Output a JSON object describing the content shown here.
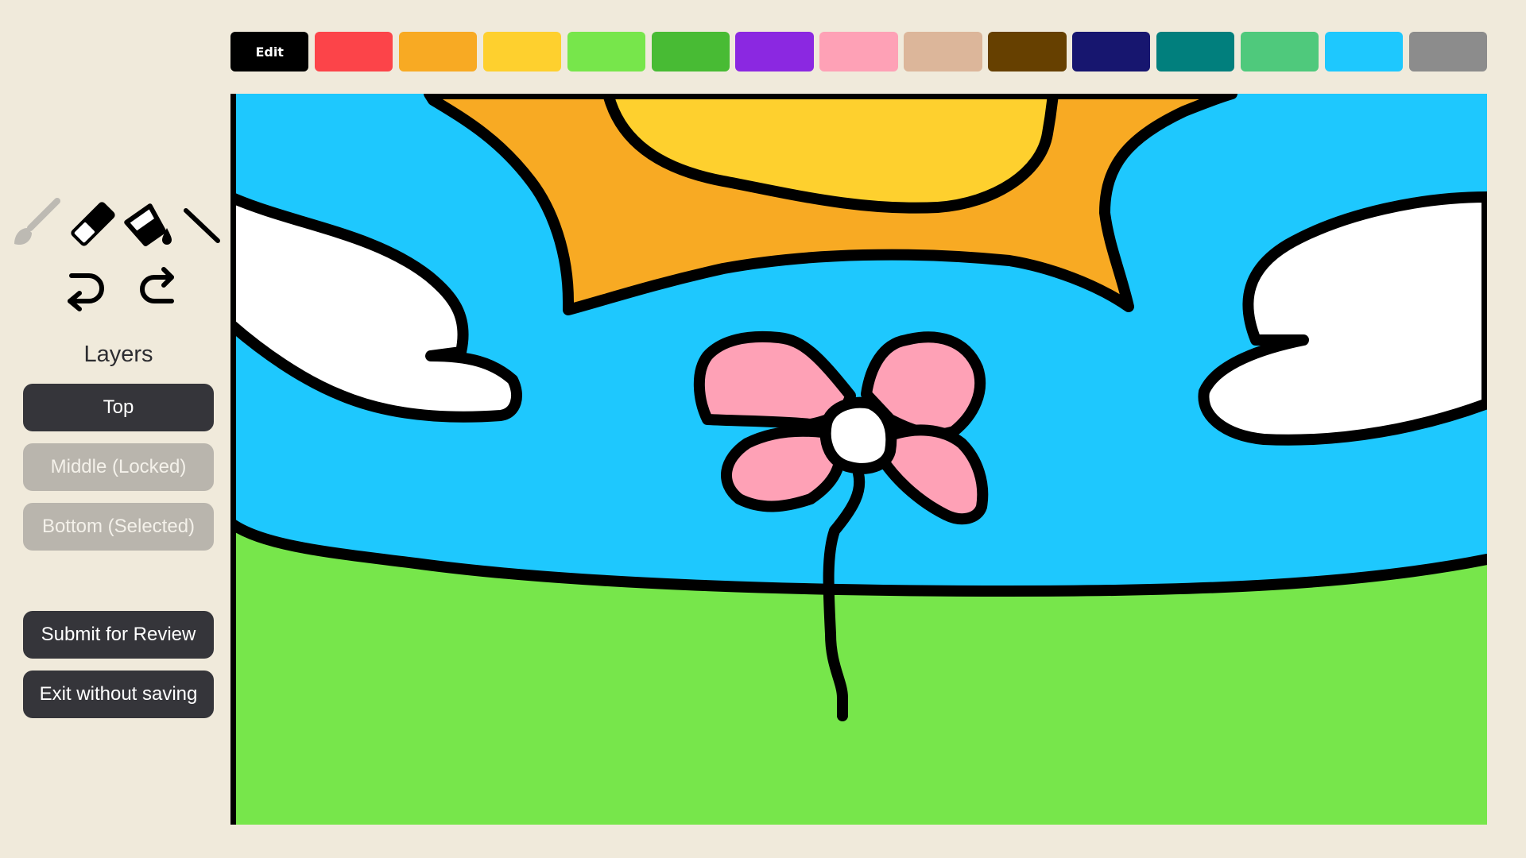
{
  "palette": {
    "edit_label": "Edit",
    "colors": [
      {
        "name": "red",
        "hex": "#fc4449"
      },
      {
        "name": "orange",
        "hex": "#f8aa23"
      },
      {
        "name": "yellow",
        "hex": "#fed02e"
      },
      {
        "name": "light-green",
        "hex": "#77e64b"
      },
      {
        "name": "green",
        "hex": "#48bb34"
      },
      {
        "name": "purple",
        "hex": "#8b28e1"
      },
      {
        "name": "pink",
        "hex": "#fea1b6"
      },
      {
        "name": "tan",
        "hex": "#dcb69a"
      },
      {
        "name": "brown",
        "hex": "#664000"
      },
      {
        "name": "navy",
        "hex": "#17166f"
      },
      {
        "name": "teal",
        "hex": "#017f7d"
      },
      {
        "name": "mint",
        "hex": "#4fc97c"
      },
      {
        "name": "sky-blue",
        "hex": "#1ec8fe"
      },
      {
        "name": "gray",
        "hex": "#8c8c8c"
      }
    ]
  },
  "tools": {
    "icons": [
      "brush-icon",
      "eraser-icon",
      "paint-bucket-icon",
      "line-icon",
      "undo-icon",
      "redo-icon"
    ],
    "active_tool": "brush"
  },
  "layers": {
    "heading": "Layers",
    "items": [
      {
        "label": "Top",
        "state": "active"
      },
      {
        "label": "Middle (Locked)",
        "state": "disabled"
      },
      {
        "label": "Bottom (Selected)",
        "state": "disabled"
      }
    ]
  },
  "actions": {
    "submit_label": "Submit for Review",
    "exit_label": "Exit without saving"
  },
  "canvas": {
    "colors": {
      "sky": "#1ec8fe",
      "grass": "#77e64b",
      "sun_rays": "#f8aa23",
      "sun": "#fed02e",
      "cloud": "#ffffff",
      "petal": "#fea1b6",
      "outline": "#000000"
    }
  }
}
